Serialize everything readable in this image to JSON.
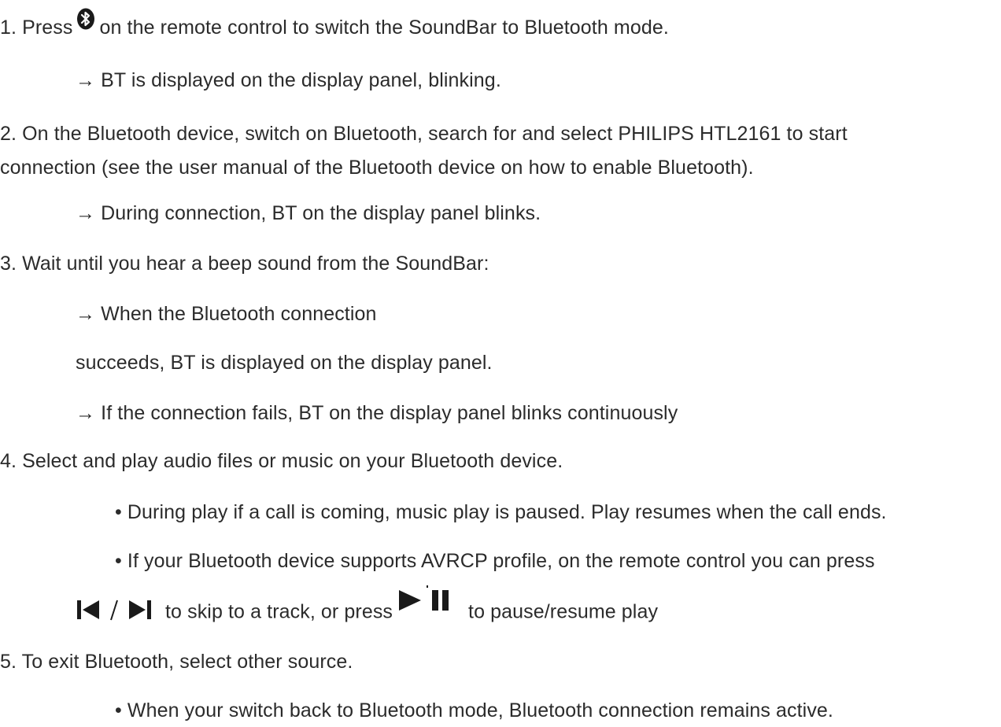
{
  "step1": {
    "prefix": "1. Press",
    "icon": "bluetooth-icon",
    "suffix": "on the remote control to switch the SoundBar to Bluetooth mode.",
    "result": "→ BT is displayed on the display panel, blinking."
  },
  "step2": {
    "line1": "2. On the Bluetooth device, switch on Bluetooth, search for and select PHILIPS HTL2161 to start",
    "line2": "connection (see the user manual of the Bluetooth device on how to enable Bluetooth).",
    "result": "→ During connection, BT on the display panel blinks."
  },
  "step3": {
    "text": "3. Wait until you hear a beep sound from the SoundBar:",
    "result_success_1": "→ When the Bluetooth connection",
    "result_success_2": "succeeds, BT is displayed on the display panel.",
    "result_fail": "→ If the connection fails, BT on the display panel blinks continuously"
  },
  "step4": {
    "text": "4. Select and play audio files or music on your Bluetooth device.",
    "note1": "• During play if a call is coming, music play is paused. Play resumes when the call ends.",
    "note2": "• If your Bluetooth device supports AVRCP profile, on the remote control you can press",
    "note2_cont_icons": "previous-next-icon",
    "note2_cont_text1": "to skip to a track, or press",
    "note2_cont_icon2": "play-pause-icon",
    "note2_cont_text2": "to pause/resume play"
  },
  "step5": {
    "text": "5. To exit Bluetooth, select other source.",
    "note": "• When your switch back to Bluetooth mode, Bluetooth connection remains active."
  },
  "colors": {
    "text": "#2b2b2b",
    "icon": "#1a1a1a"
  }
}
